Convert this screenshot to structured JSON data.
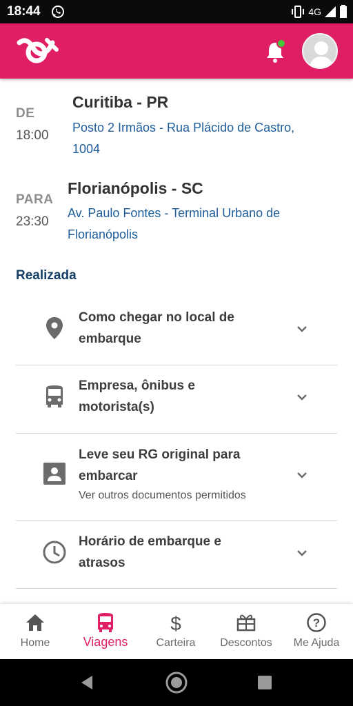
{
  "status_bar": {
    "time": "18:44",
    "network": "4G",
    "icons": [
      "whatsapp-icon",
      "vibrate-icon",
      "signal-icon",
      "battery-icon"
    ]
  },
  "app_bar": {
    "brand_color": "#e01e65",
    "logo": "buser-logo",
    "notification_dot_color": "#43c83a"
  },
  "trip": {
    "origin": {
      "label": "DE",
      "time": "18:00",
      "city": "Curitiba - PR",
      "address_line1": "Posto 2 Irmãos - Rua Plácido de Castro,",
      "address_line2": "1004"
    },
    "destination": {
      "label": "PARA",
      "time": "23:30",
      "city": "Florianópolis - SC",
      "address_line1": "Av. Paulo Fontes - Terminal Urbano de",
      "address_line2": "Florianópolis"
    },
    "status": "Realizada"
  },
  "sections": [
    {
      "icon": "map-pin-icon",
      "title_line1": "Como chegar no local de",
      "title_line2": "embarque"
    },
    {
      "icon": "bus-icon",
      "title_line1": "Empresa, ônibus e",
      "title_line2": "motorista(s)"
    },
    {
      "icon": "id-card-icon",
      "title_line1": "Leve seu RG original para",
      "title_line2": "embarcar",
      "subtitle": "Ver outros documentos permitidos"
    },
    {
      "icon": "clock-icon",
      "title_line1": "Horário de embarque e",
      "title_line2": "atrasos"
    }
  ],
  "bottom_nav": {
    "active_color": "#e01e65",
    "items": [
      {
        "label": "Home",
        "icon": "home-icon"
      },
      {
        "label": "Viagens",
        "icon": "bus-icon"
      },
      {
        "label": "Carteira",
        "icon": "dollar-icon"
      },
      {
        "label": "Descontos",
        "icon": "gift-icon"
      },
      {
        "label": "Me Ajuda",
        "icon": "help-icon"
      }
    ]
  },
  "android_nav": {
    "buttons": [
      "back-button",
      "home-button",
      "recents-button"
    ]
  }
}
